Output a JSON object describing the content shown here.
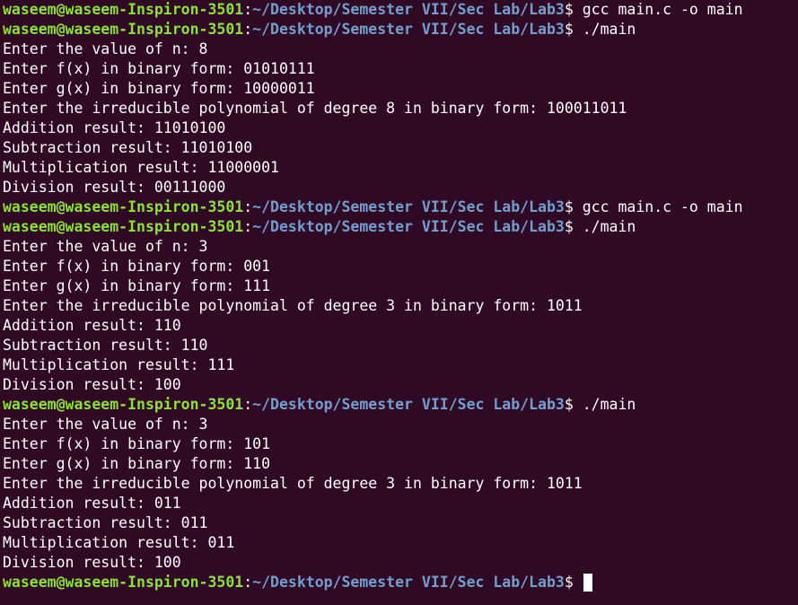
{
  "prompt": {
    "user_host": "waseem@waseem-Inspiron-3501",
    "separator": ":",
    "path": "~/Desktop/Semester VII/Sec Lab/Lab3",
    "dollar": "$ "
  },
  "lines": [
    {
      "type": "prompt",
      "cmd": "gcc main.c -o main"
    },
    {
      "type": "prompt",
      "cmd": "./main"
    },
    {
      "type": "out",
      "text": "Enter the value of n: 8"
    },
    {
      "type": "out",
      "text": "Enter f(x) in binary form: 01010111"
    },
    {
      "type": "out",
      "text": "Enter g(x) in binary form: 10000011"
    },
    {
      "type": "out",
      "text": "Enter the irreducible polynomial of degree 8 in binary form: 100011011"
    },
    {
      "type": "out",
      "text": "Addition result: 11010100"
    },
    {
      "type": "out",
      "text": "Subtraction result: 11010100"
    },
    {
      "type": "out",
      "text": "Multiplication result: 11000001"
    },
    {
      "type": "out",
      "text": "Division result: 00111000"
    },
    {
      "type": "prompt",
      "cmd": "gcc main.c -o main"
    },
    {
      "type": "prompt",
      "cmd": "./main"
    },
    {
      "type": "out",
      "text": "Enter the value of n: 3"
    },
    {
      "type": "out",
      "text": "Enter f(x) in binary form: 001"
    },
    {
      "type": "out",
      "text": "Enter g(x) in binary form: 111"
    },
    {
      "type": "out",
      "text": "Enter the irreducible polynomial of degree 3 in binary form: 1011"
    },
    {
      "type": "out",
      "text": "Addition result: 110"
    },
    {
      "type": "out",
      "text": "Subtraction result: 110"
    },
    {
      "type": "out",
      "text": "Multiplication result: 111"
    },
    {
      "type": "out",
      "text": "Division result: 100"
    },
    {
      "type": "prompt",
      "cmd": "./main"
    },
    {
      "type": "out",
      "text": "Enter the value of n: 3"
    },
    {
      "type": "out",
      "text": "Enter f(x) in binary form: 101"
    },
    {
      "type": "out",
      "text": "Enter g(x) in binary form: 110"
    },
    {
      "type": "out",
      "text": "Enter the irreducible polynomial of degree 3 in binary form: 1011"
    },
    {
      "type": "out",
      "text": "Addition result: 011"
    },
    {
      "type": "out",
      "text": "Subtraction result: 011"
    },
    {
      "type": "out",
      "text": "Multiplication result: 011"
    },
    {
      "type": "out",
      "text": "Division result: 100"
    },
    {
      "type": "prompt",
      "cmd": "",
      "cursor": true
    }
  ],
  "colors": {
    "background": "#300a24",
    "user_host": "#8ae234",
    "path": "#729fcf",
    "text": "#ffffff"
  }
}
